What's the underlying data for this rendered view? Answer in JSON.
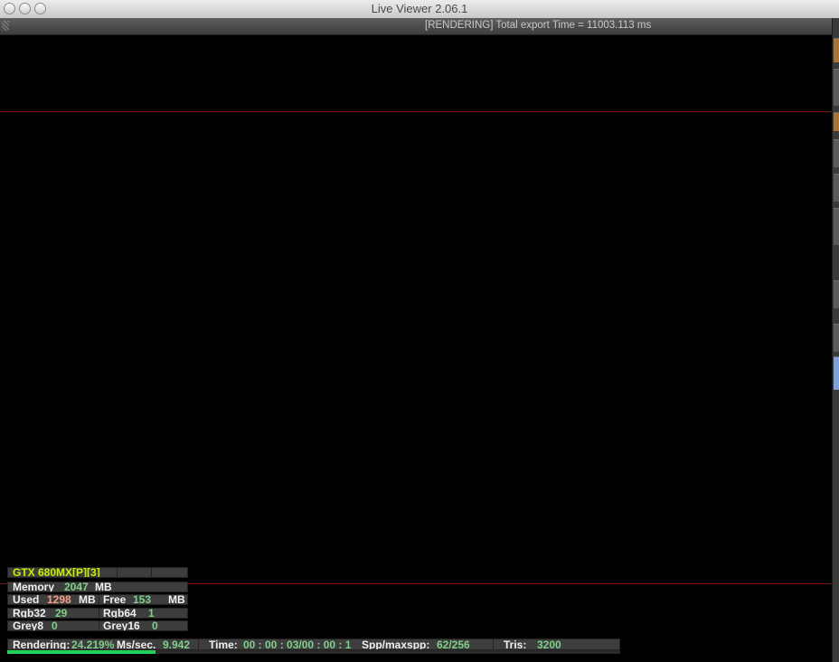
{
  "window": {
    "title": "Live Viewer 2.06.1"
  },
  "status": {
    "text": "[RENDERING] Total export Time = 11003.113 ms"
  },
  "gpu": {
    "name": "GTX 680MX[P][3]",
    "memory_label": "Memory",
    "memory_value": "2047",
    "memory_unit": "MB",
    "used_label": "Used",
    "used_value": "1298",
    "used_unit": "MB",
    "free_label": "Free",
    "free_value": "153",
    "free_unit": "MB",
    "rgb32_label": "Rgb32",
    "rgb32_value": "29",
    "rgb64_label": "Rgb64",
    "rgb64_value": "1",
    "grey8_label": "Grey8",
    "grey8_value": "0",
    "grey16_label": "Grey16",
    "grey16_value": "0"
  },
  "render": {
    "label": "Rendering:",
    "percent": "24.219%",
    "progress_fraction": 0.24219,
    "mssec_label": "Ms/sec.",
    "mssec_value": "9.942",
    "time_label": "Time:",
    "time_value": "00 : 00 : 03/00 : 00 : 1",
    "spp_label": "Spp/maxspp:",
    "spp_value": "62/256",
    "tris_label": "Tris:",
    "tris_value": "3200"
  },
  "colors": {
    "accent_green": "#7fd08a",
    "used_red": "#f4a089",
    "gpu_yellow": "#c8f000",
    "progress": "#22d05a",
    "guide_red": "#7a1010"
  }
}
